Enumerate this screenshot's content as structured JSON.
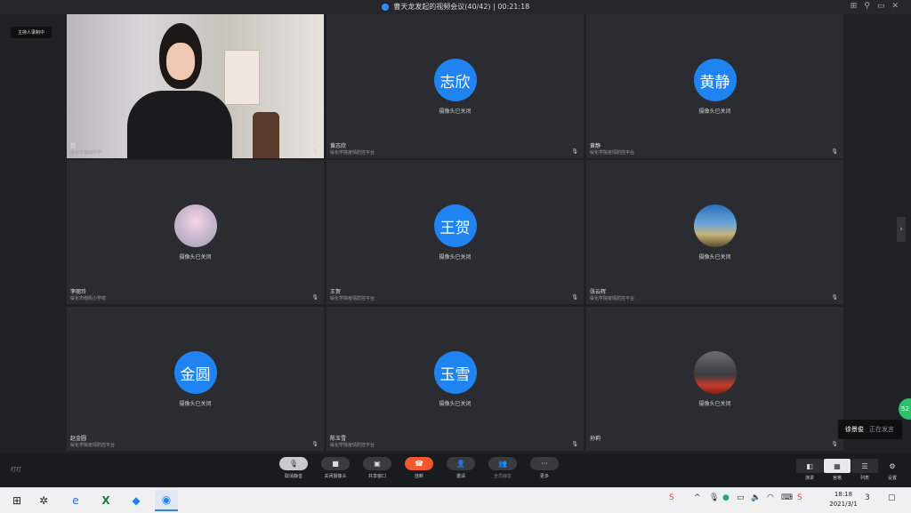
{
  "window": {
    "title": "曹天龙发起的视频会议(40/42)",
    "separator": "|",
    "timer": "00:21:18",
    "controls": [
      "⊞",
      "⚲",
      "▭",
      "✕"
    ]
  },
  "host_recording": "主持人录制中",
  "participants": [
    {
      "name": "我",
      "org": "绥化市第四中学",
      "type": "video"
    },
    {
      "name": "黄志欣",
      "org": "绥化学院疫情防控平台",
      "type": "avatar",
      "avatar_text": "志欣",
      "status": "摄像头已关闭"
    },
    {
      "name": "黄静",
      "org": "绥化学院疫情防控平台",
      "type": "avatar",
      "avatar_text": "黄静",
      "status": "摄像头已关闭"
    },
    {
      "name": "李丽玲",
      "org": "绥化市南街小学校",
      "type": "image",
      "status": "摄像头已关闭"
    },
    {
      "name": "王贺",
      "org": "绥化学院疫情防控平台",
      "type": "avatar",
      "avatar_text": "王贺",
      "status": "摄像头已关闭"
    },
    {
      "name": "张云辉",
      "org": "绥化学院疫情防控平台",
      "type": "image",
      "status": "摄像头已关闭"
    },
    {
      "name": "赵金圆",
      "org": "绥化学院疫情防控平台",
      "type": "avatar",
      "avatar_text": "金圆",
      "status": "摄像头已关闭"
    },
    {
      "name": "陈玉雪",
      "org": "绥化学院疫情防控平台",
      "type": "avatar",
      "avatar_text": "玉雪",
      "status": "摄像头已关闭"
    },
    {
      "name": "孙莉",
      "org": "",
      "type": "image",
      "status": "摄像头已关闭"
    }
  ],
  "speaker_toast": {
    "name": "徐景俊",
    "status": "正在发言"
  },
  "green_badge": "52",
  "toolbar": {
    "left_label": "打打",
    "buttons": [
      {
        "label": "取消静音",
        "icon": "mic"
      },
      {
        "label": "关闭摄像头",
        "icon": "camera"
      },
      {
        "label": "共享窗口",
        "icon": "share"
      },
      {
        "label": "挂断",
        "icon": "hangup"
      },
      {
        "label": "邀请",
        "icon": "invite"
      },
      {
        "label": "全员静音",
        "icon": "mute-all"
      },
      {
        "label": "更多",
        "icon": "more"
      }
    ],
    "views": [
      {
        "label": "演讲"
      },
      {
        "label": "宫格"
      },
      {
        "label": "列表"
      },
      {
        "label": "设置"
      }
    ]
  },
  "taskbar": {
    "clock_time": "18:18",
    "clock_date": "2021/3/1",
    "tray_badge": "3"
  }
}
